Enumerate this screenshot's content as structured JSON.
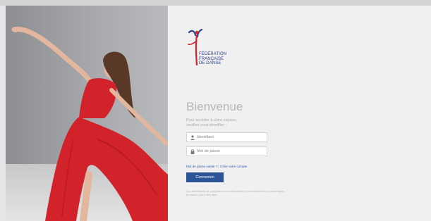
{
  "logo": {
    "line1": "FÉDÉRATION",
    "line2": "FRANÇAISE",
    "line3": "DE DANSE"
  },
  "login": {
    "title": "Bienvenue",
    "intro_line1": "Pour accéder à votre espace,",
    "intro_line2": "veuillez vous identifier :",
    "username_placeholder": "Identifiant",
    "password_placeholder": "Mot de passe",
    "forgot_password": "Mot de passe oublié ?",
    "separator": "|",
    "create_account": "Créer votre compte",
    "submit_label": "Connexion",
    "footer_note": "Vos identifiants de connexion sont personnels et ne doivent être communiqués en aucun cas à des tiers."
  },
  "colors": {
    "accent": "#2d5496",
    "dress": "#d2232a"
  }
}
